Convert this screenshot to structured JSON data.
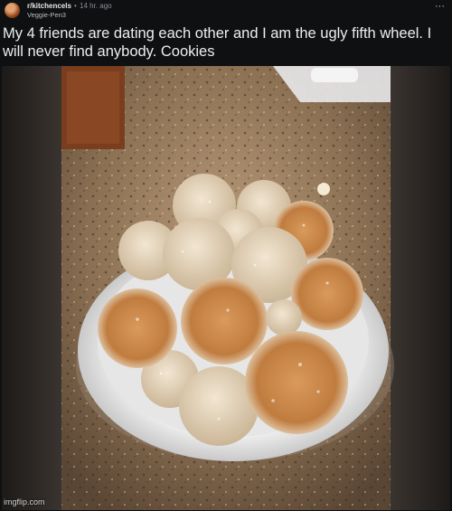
{
  "post": {
    "subreddit": "r/kitchencels",
    "separator": "•",
    "time_ago": "14 hr. ago",
    "username": "Veggie-Pen3",
    "more_label": "···",
    "title": "My 4 friends are dating each other and I am the ugly fifth wheel. I will never find anybody. Cookies"
  },
  "watermark": "imgflip.com",
  "colors": {
    "background": "#0e1012",
    "text": "#eceef0",
    "muted": "#8a9096"
  }
}
